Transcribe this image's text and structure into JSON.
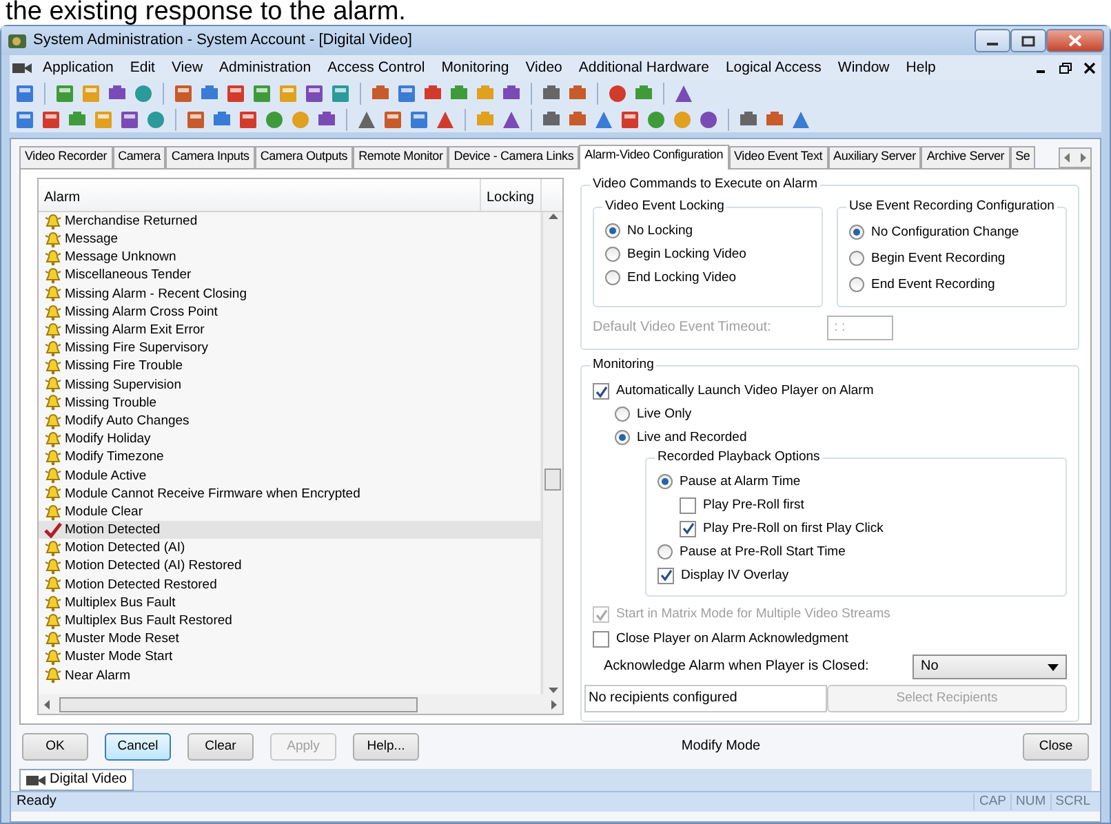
{
  "caption_text": "the existing response to the alarm.",
  "window": {
    "title": "System Administration - System Account - [Digital Video]"
  },
  "menu": [
    "Application",
    "Edit",
    "View",
    "Administration",
    "Access Control",
    "Monitoring",
    "Video",
    "Additional Hardware",
    "Logical Access",
    "Window",
    "Help"
  ],
  "tabs": [
    {
      "label": "Video Recorder",
      "selected": false
    },
    {
      "label": "Camera",
      "selected": false
    },
    {
      "label": "Camera Inputs",
      "selected": false
    },
    {
      "label": "Camera Outputs",
      "selected": false
    },
    {
      "label": "Remote Monitor",
      "selected": false
    },
    {
      "label": "Device - Camera Links",
      "selected": false
    },
    {
      "label": "Alarm-Video Configuration",
      "selected": true
    },
    {
      "label": "Video Event Text",
      "selected": false
    },
    {
      "label": "Auxiliary Server",
      "selected": false
    },
    {
      "label": "Archive Server",
      "selected": false
    },
    {
      "label": "Se",
      "selected": false
    }
  ],
  "alarm_table": {
    "columns": [
      "Alarm",
      "Locking"
    ],
    "rows": [
      {
        "name": "Merchandise Returned",
        "kind": "bell",
        "selected": false
      },
      {
        "name": "Message",
        "kind": "bell",
        "selected": false
      },
      {
        "name": "Message Unknown",
        "kind": "bell",
        "selected": false
      },
      {
        "name": "Miscellaneous Tender",
        "kind": "bell",
        "selected": false
      },
      {
        "name": "Missing Alarm - Recent Closing",
        "kind": "bell",
        "selected": false
      },
      {
        "name": "Missing Alarm Cross Point",
        "kind": "bell",
        "selected": false
      },
      {
        "name": "Missing Alarm Exit Error",
        "kind": "bell",
        "selected": false
      },
      {
        "name": "Missing Fire Supervisory",
        "kind": "bell",
        "selected": false
      },
      {
        "name": "Missing Fire Trouble",
        "kind": "bell",
        "selected": false
      },
      {
        "name": "Missing Supervision",
        "kind": "bell",
        "selected": false
      },
      {
        "name": "Missing Trouble",
        "kind": "bell",
        "selected": false
      },
      {
        "name": "Modify Auto Changes",
        "kind": "bell",
        "selected": false
      },
      {
        "name": "Modify Holiday",
        "kind": "bell",
        "selected": false
      },
      {
        "name": "Modify Timezone",
        "kind": "bell",
        "selected": false
      },
      {
        "name": "Module Active",
        "kind": "bell",
        "selected": false
      },
      {
        "name": "Module Cannot Receive Firmware when Encrypted",
        "kind": "bell",
        "selected": false
      },
      {
        "name": "Module Clear",
        "kind": "bell",
        "selected": false
      },
      {
        "name": "Motion Detected",
        "kind": "check",
        "selected": true
      },
      {
        "name": "Motion Detected (AI)",
        "kind": "bell",
        "selected": false
      },
      {
        "name": "Motion Detected (AI) Restored",
        "kind": "bell",
        "selected": false
      },
      {
        "name": "Motion Detected Restored",
        "kind": "bell",
        "selected": false
      },
      {
        "name": "Multiplex Bus Fault",
        "kind": "bell",
        "selected": false
      },
      {
        "name": "Multiplex Bus Fault Restored",
        "kind": "bell",
        "selected": false
      },
      {
        "name": "Muster Mode Reset",
        "kind": "bell",
        "selected": false
      },
      {
        "name": "Muster Mode Start",
        "kind": "bell",
        "selected": false
      },
      {
        "name": "Near Alarm",
        "kind": "bell",
        "selected": false
      }
    ]
  },
  "video_commands": {
    "title": "Video Commands to Execute on Alarm",
    "locking": {
      "title": "Video Event Locking",
      "options": [
        {
          "label": "No Locking",
          "selected": true
        },
        {
          "label": "Begin Locking Video",
          "selected": false
        },
        {
          "label": "End Locking Video",
          "selected": false
        }
      ]
    },
    "recording": {
      "title": "Use Event Recording Configuration",
      "options": [
        {
          "label": "No Configuration Change",
          "selected": true
        },
        {
          "label": "Begin Event Recording",
          "selected": false
        },
        {
          "label": "End Event Recording",
          "selected": false
        }
      ]
    },
    "timeout": {
      "label": "Default Video Event Timeout:",
      "value": ": :",
      "disabled": true
    }
  },
  "monitoring": {
    "title": "Monitoring",
    "auto_launch": {
      "label": "Automatically Launch Video Player on Alarm",
      "checked": true
    },
    "live_options": [
      {
        "label": "Live Only",
        "selected": false
      },
      {
        "label": "Live and Recorded",
        "selected": true
      }
    ],
    "playback": {
      "title": "Recorded Playback Options",
      "items": [
        {
          "kind": "radio",
          "label": "Pause at Alarm Time",
          "selected": true,
          "children": [
            {
              "kind": "checkbox",
              "label": "Play Pre-Roll first",
              "checked": false
            },
            {
              "kind": "checkbox",
              "label": "Play Pre-Roll on first Play Click",
              "checked": true
            }
          ]
        },
        {
          "kind": "radio",
          "label": "Pause at Pre-Roll Start Time",
          "selected": false
        },
        {
          "kind": "checkbox",
          "label": "Display IV Overlay",
          "checked": true
        }
      ]
    },
    "matrix": {
      "label": "Start in Matrix Mode for Multiple Video Streams",
      "checked": true,
      "disabled": true
    },
    "close_player": {
      "label": "Close Player on Alarm Acknowledgment",
      "checked": false,
      "disabled": false
    },
    "acknowledge": {
      "label": "Acknowledge Alarm when Player is Closed:",
      "value": "No"
    },
    "recipients": {
      "text": "No recipients configured",
      "button": "Select Recipients",
      "disabled": true
    }
  },
  "footer": {
    "buttons": [
      {
        "label": "OK",
        "disabled": false,
        "focused": false
      },
      {
        "label": "Cancel",
        "disabled": false,
        "focused": true
      },
      {
        "label": "Clear",
        "disabled": false,
        "focused": false
      },
      {
        "label": "Apply",
        "disabled": true,
        "focused": false
      },
      {
        "label": "Help...",
        "disabled": false,
        "focused": false
      }
    ],
    "mode": "Modify Mode",
    "close": "Close"
  },
  "mdi_tab": "Digital Video",
  "status_bar": {
    "text": "Ready",
    "indicators": [
      {
        "label": "CAP",
        "on": false
      },
      {
        "label": "NUM",
        "on": false
      },
      {
        "label": "SCRL",
        "on": false
      }
    ]
  }
}
